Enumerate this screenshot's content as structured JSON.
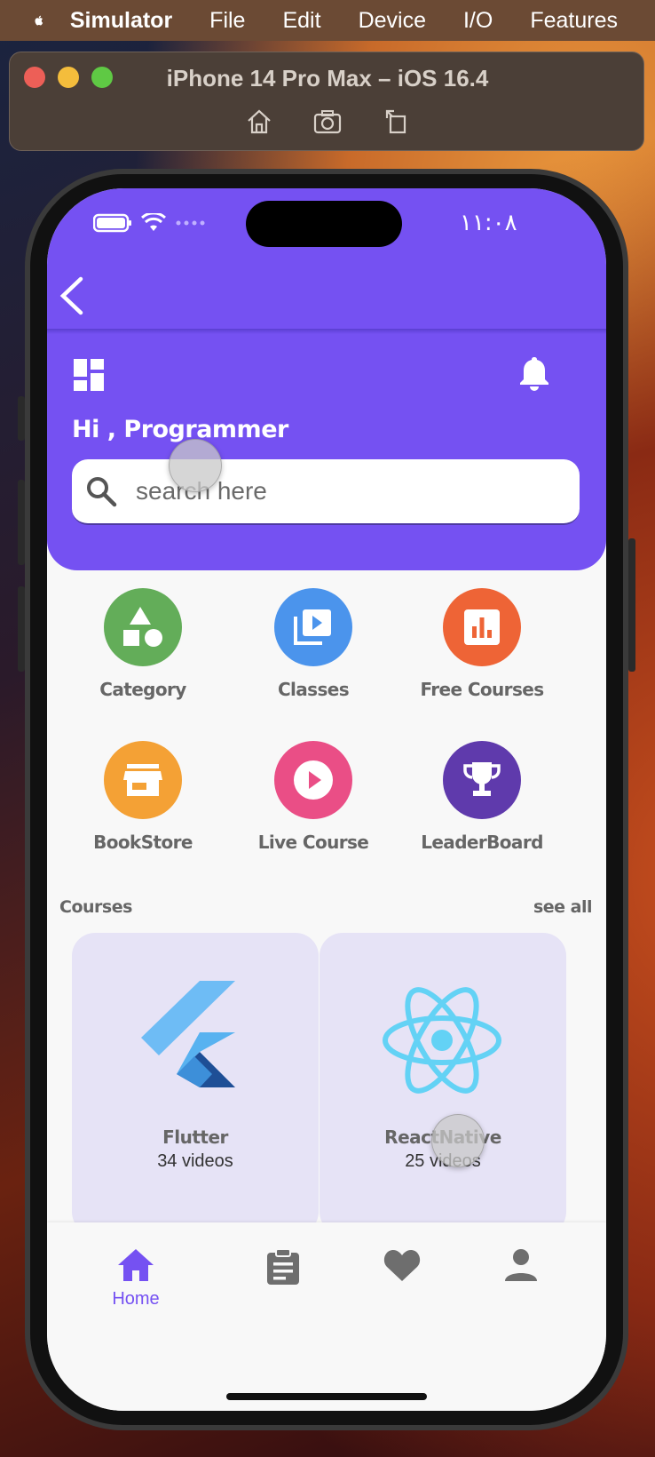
{
  "menubar": {
    "app_name": "Simulator",
    "items": [
      "File",
      "Edit",
      "Device",
      "I/O",
      "Features"
    ]
  },
  "simulator": {
    "title": "iPhone 14 Pro Max – iOS 16.4",
    "toolbar_icons": [
      "home-icon",
      "screenshot-icon",
      "rotate-icon"
    ]
  },
  "status_bar": {
    "time": "١١:٠٨",
    "icons": [
      "battery-icon",
      "wifi-icon",
      "signal-icon"
    ]
  },
  "header": {
    "greeting": "Hi , Programmer",
    "search_placeholder": "search here",
    "accent_color": "#7551f2"
  },
  "categories": [
    {
      "label": "Category",
      "icon": "shapes-icon",
      "color": "#63ad59"
    },
    {
      "label": "Classes",
      "icon": "video-library-icon",
      "color": "#4b94ec"
    },
    {
      "label": "Free Courses",
      "icon": "chart-icon",
      "color": "#ee6436"
    },
    {
      "label": "BookStore",
      "icon": "store-icon",
      "color": "#f4a135"
    },
    {
      "label": "Live Course",
      "icon": "play-circle-icon",
      "color": "#ea4e86"
    },
    {
      "label": "LeaderBoard",
      "icon": "trophy-icon",
      "color": "#5f3aac"
    }
  ],
  "courses": {
    "title": "Courses",
    "see_all": "see all",
    "items": [
      {
        "name": "Flutter",
        "videos": "34 videos",
        "icon": "flutter-logo"
      },
      {
        "name": "ReactNative",
        "videos": "25 videos",
        "icon": "react-logo"
      }
    ]
  },
  "bottom_nav": {
    "items": [
      {
        "label": "Home",
        "icon": "home-icon",
        "active": true
      },
      {
        "label": "",
        "icon": "clipboard-icon",
        "active": false
      },
      {
        "label": "",
        "icon": "heart-icon",
        "active": false
      },
      {
        "label": "",
        "icon": "person-icon",
        "active": false
      }
    ]
  }
}
